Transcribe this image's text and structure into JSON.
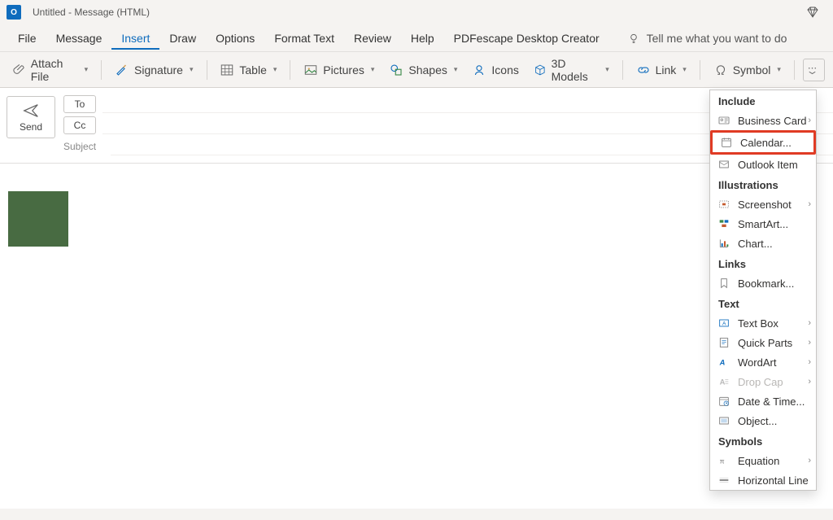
{
  "window": {
    "title": "Untitled  -  Message (HTML)"
  },
  "menubar": {
    "items": [
      "File",
      "Message",
      "Insert",
      "Draw",
      "Options",
      "Format Text",
      "Review",
      "Help",
      "PDFescape Desktop Creator"
    ],
    "active": "Insert",
    "tellme": "Tell me what you want to do"
  },
  "ribbon": {
    "attach": "Attach File",
    "signature": "Signature",
    "table": "Table",
    "pictures": "Pictures",
    "shapes": "Shapes",
    "icons": "Icons",
    "models": "3D Models",
    "link": "Link",
    "symbol": "Symbol"
  },
  "compose": {
    "send": "Send",
    "to": "To",
    "cc": "Cc",
    "subject": "Subject"
  },
  "overflow": {
    "sections": {
      "include": "Include",
      "illustrations": "Illustrations",
      "links": "Links",
      "text": "Text",
      "symbols": "Symbols"
    },
    "items": {
      "business_card": "Business Card",
      "calendar": "Calendar...",
      "outlook_item": "Outlook Item",
      "screenshot": "Screenshot",
      "smartart": "SmartArt...",
      "chart": "Chart...",
      "bookmark": "Bookmark...",
      "text_box": "Text Box",
      "quick_parts": "Quick Parts",
      "wordart": "WordArt",
      "drop_cap": "Drop Cap",
      "date_time": "Date & Time...",
      "object": "Object...",
      "equation": "Equation",
      "horizontal": "Horizontal Line"
    }
  }
}
